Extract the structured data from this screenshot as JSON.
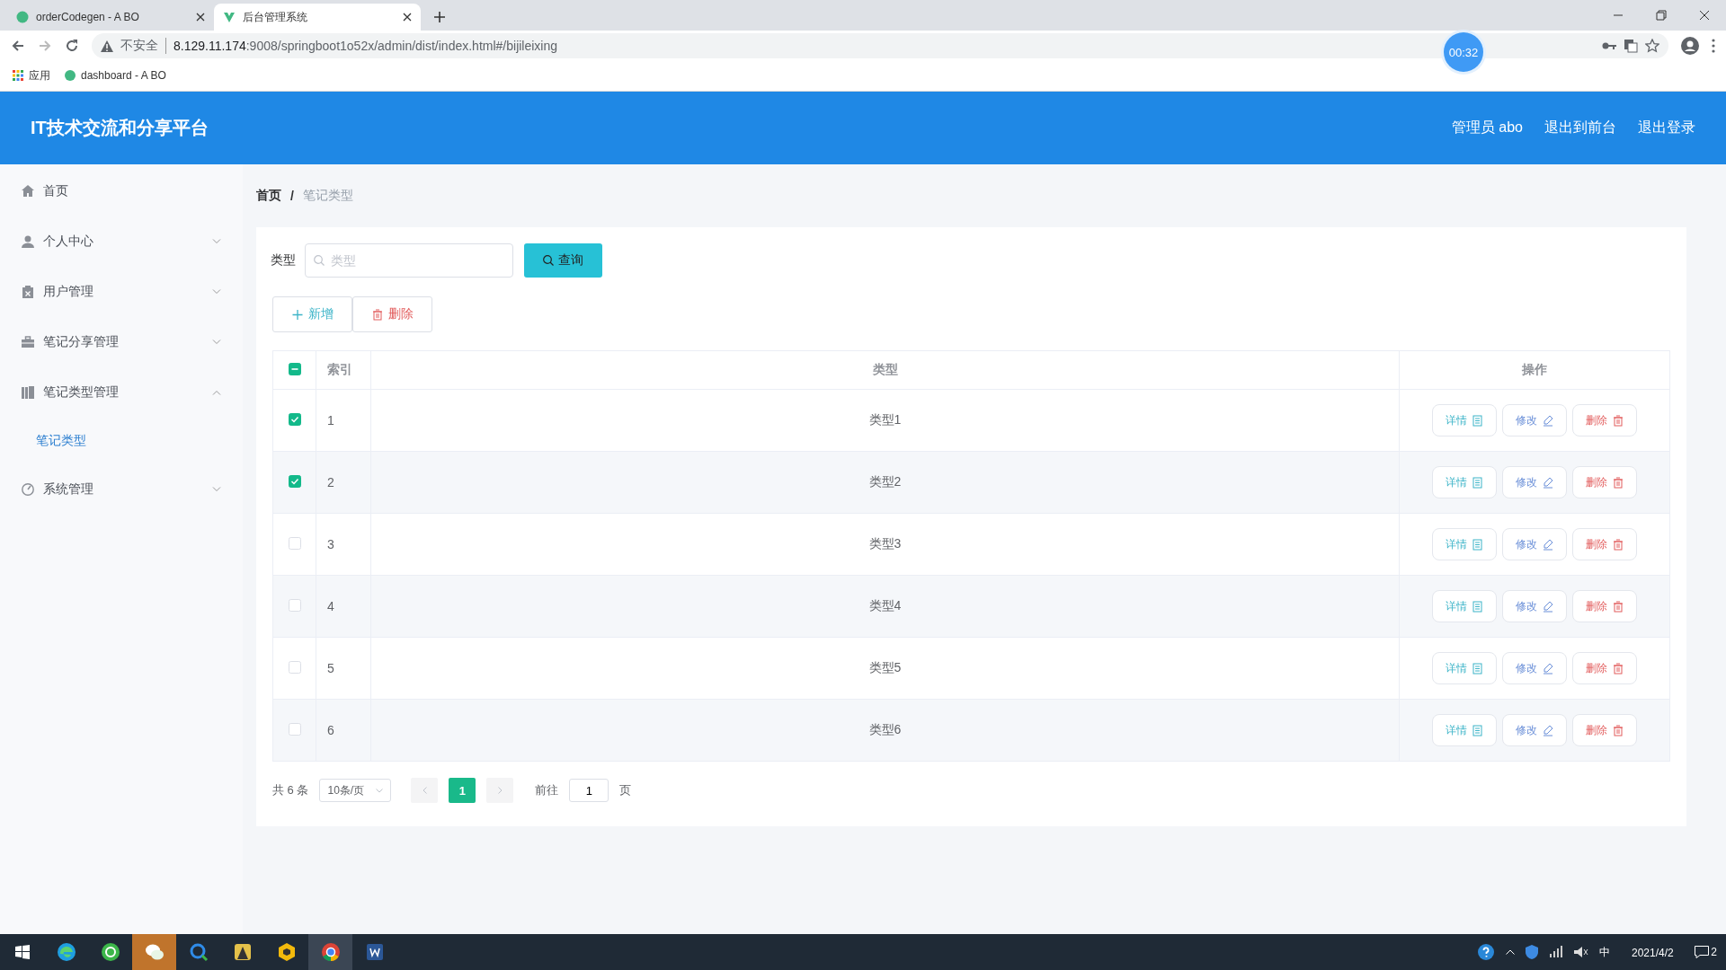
{
  "browser": {
    "tabs": [
      {
        "title": "orderCodegen - A BO",
        "selected": false
      },
      {
        "title": "后台管理系统",
        "selected": true
      }
    ],
    "security": "不安全",
    "url_host": "8.129.11.174",
    "url_rest": ":9008/springboot1o52x/admin/dist/index.html#/bijileixing",
    "bookmarks": [
      "应用",
      "dashboard - A BO"
    ],
    "timer": "00:32"
  },
  "header": {
    "title": "IT技术交流和分享平台",
    "links": [
      "管理员 abo",
      "退出到前台",
      "退出登录"
    ]
  },
  "sidebar": {
    "items": [
      {
        "label": "首页",
        "kind": "link"
      },
      {
        "label": "个人中心",
        "kind": "group",
        "expanded": false
      },
      {
        "label": "用户管理",
        "kind": "group",
        "expanded": false
      },
      {
        "label": "笔记分享管理",
        "kind": "group",
        "expanded": false
      },
      {
        "label": "笔记类型管理",
        "kind": "group",
        "expanded": true,
        "children": [
          {
            "label": "笔记类型",
            "selected": true
          }
        ]
      },
      {
        "label": "系统管理",
        "kind": "group",
        "expanded": false
      }
    ]
  },
  "breadcrumb": [
    "首页",
    "笔记类型"
  ],
  "breadcrumb_separator": "/",
  "search": {
    "label": "类型",
    "placeholder": "类型",
    "button": "查询"
  },
  "actions": [
    {
      "label": "新增",
      "kind": "add"
    },
    {
      "label": "删除",
      "kind": "delete"
    }
  ],
  "table": {
    "columns": [
      "索引",
      "类型",
      "操作"
    ],
    "select_all": {
      "checked": false,
      "indeterminate": true
    },
    "rows": [
      {
        "index": "1",
        "type": "类型1",
        "checked": true,
        "actions": [
          {
            "label": "详情",
            "kind": "detail"
          },
          {
            "label": "修改",
            "kind": "edit"
          },
          {
            "label": "删除",
            "kind": "delete"
          }
        ]
      },
      {
        "index": "2",
        "type": "类型2",
        "checked": true,
        "actions": [
          {
            "label": "详情",
            "kind": "detail"
          },
          {
            "label": "修改",
            "kind": "edit"
          },
          {
            "label": "删除",
            "kind": "delete"
          }
        ]
      },
      {
        "index": "3",
        "type": "类型3",
        "checked": false,
        "actions": [
          {
            "label": "详情",
            "kind": "detail"
          },
          {
            "label": "修改",
            "kind": "edit"
          },
          {
            "label": "删除",
            "kind": "delete"
          }
        ]
      },
      {
        "index": "4",
        "type": "类型4",
        "checked": false,
        "actions": [
          {
            "label": "详情",
            "kind": "detail"
          },
          {
            "label": "修改",
            "kind": "edit"
          },
          {
            "label": "删除",
            "kind": "delete"
          }
        ]
      },
      {
        "index": "5",
        "type": "类型5",
        "checked": false,
        "actions": [
          {
            "label": "详情",
            "kind": "detail"
          },
          {
            "label": "修改",
            "kind": "edit"
          },
          {
            "label": "删除",
            "kind": "delete"
          }
        ]
      },
      {
        "index": "6",
        "type": "类型6",
        "checked": false,
        "actions": [
          {
            "label": "详情",
            "kind": "detail"
          },
          {
            "label": "修改",
            "kind": "edit"
          },
          {
            "label": "删除",
            "kind": "delete"
          }
        ]
      }
    ]
  },
  "pagination": {
    "total": "共 6 条",
    "page_size": "10条/页",
    "pages": [
      {
        "label": "1",
        "selected": true
      }
    ],
    "goto_label": "前往",
    "goto_value": "1",
    "goto_suffix": "页"
  },
  "taskbar": {
    "apps": [
      {
        "active": false
      },
      {
        "active": false
      },
      {
        "active": true
      },
      {
        "active": false
      },
      {
        "active": false
      },
      {
        "active": false
      },
      {
        "active": true
      },
      {
        "active": false
      }
    ],
    "ime": "中",
    "date": "2021/4/2",
    "notifications": "2"
  }
}
